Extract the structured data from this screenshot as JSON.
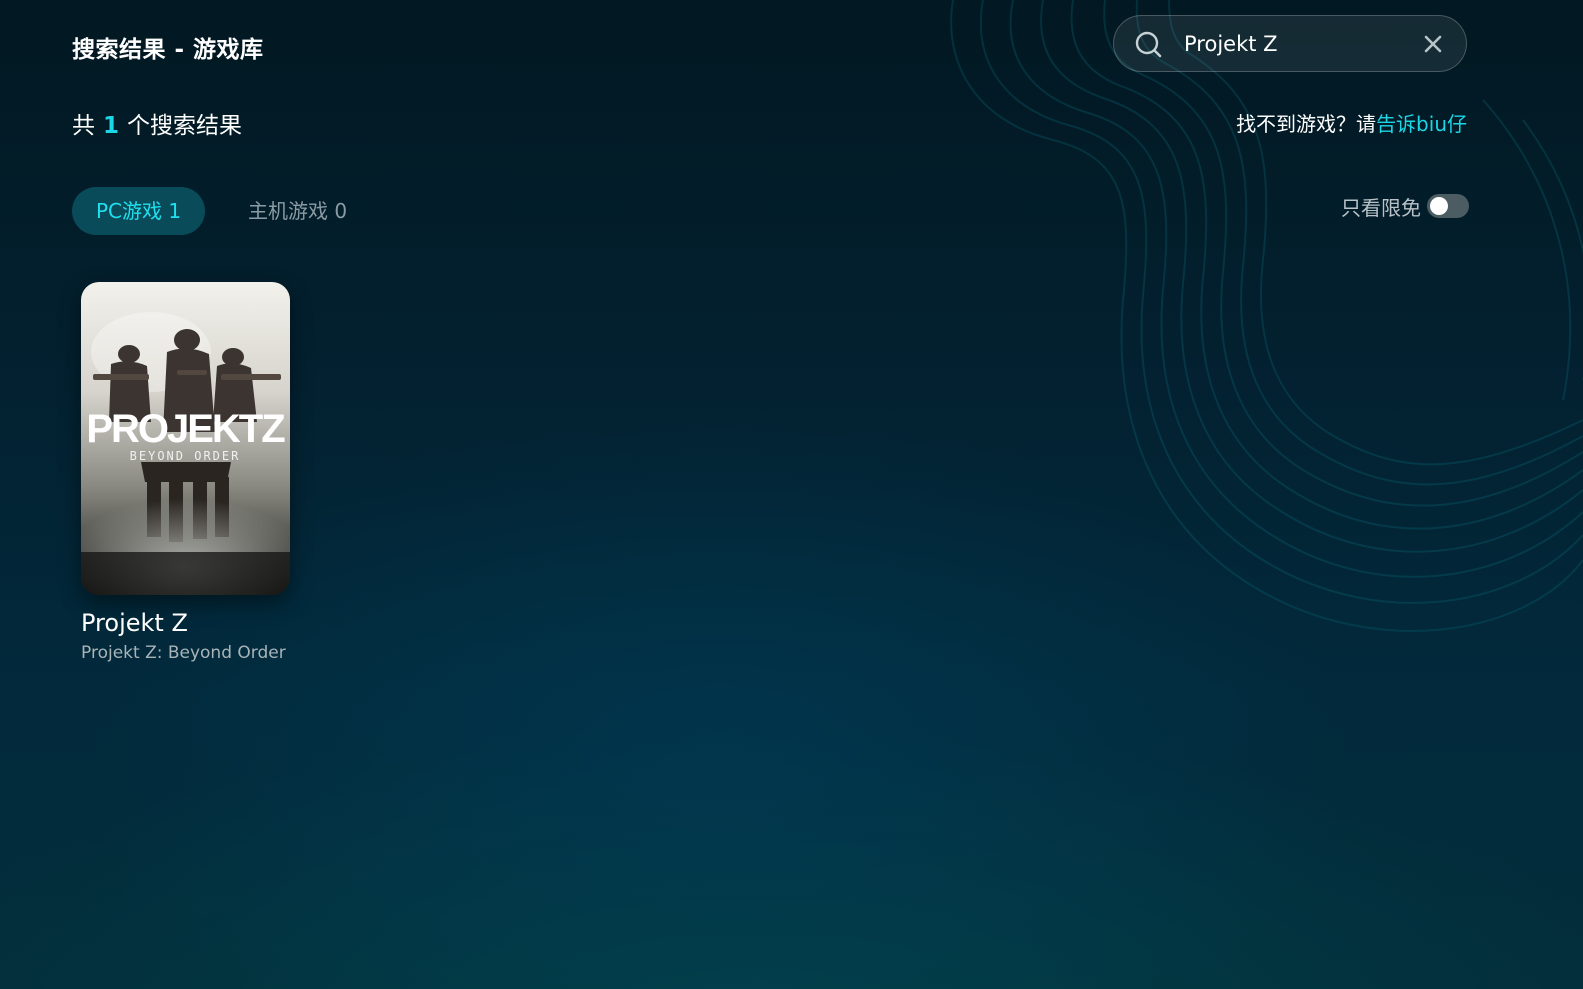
{
  "header": {
    "title": "搜索结果 - 游戏库"
  },
  "search": {
    "value": "Projekt Z",
    "placeholder": ""
  },
  "results": {
    "prefix": "共",
    "count": "1",
    "suffix": "个搜索结果"
  },
  "help": {
    "question": "找不到游戏？请",
    "link": "告诉biu仔"
  },
  "tabs": [
    {
      "label": "PC游戏 1",
      "active": true
    },
    {
      "label": "主机游戏 0",
      "active": false
    }
  ],
  "filter": {
    "label": "只看限免",
    "enabled": false
  },
  "games": [
    {
      "title": "Projekt Z",
      "subtitle": "Projekt Z: Beyond Order",
      "cover_art_text": "PROJEKTZ",
      "cover_art_subtext": "BEYOND ORDER"
    }
  ],
  "colors": {
    "accent": "#1cd6e6",
    "tab_active_bg": "#0a4b5a",
    "background": "#03202f"
  },
  "icons": [
    "search-icon",
    "close-icon"
  ]
}
